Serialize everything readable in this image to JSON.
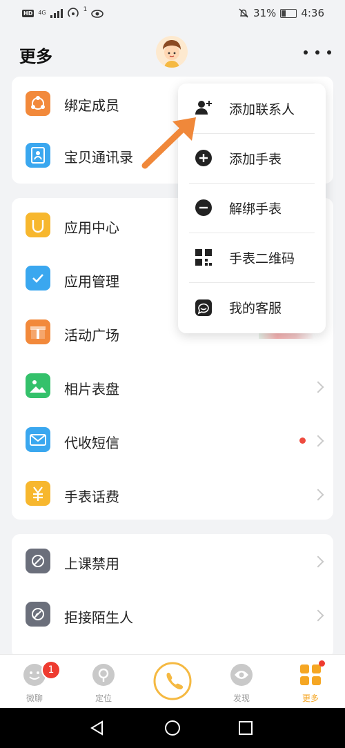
{
  "status_bar": {
    "signal_tag_left": "HD",
    "signal_small": "4G",
    "superscript": "1",
    "battery": "31%",
    "battery_level": 0.31,
    "time": "4:36"
  },
  "header": {
    "title": "更多"
  },
  "card1": {
    "items": [
      {
        "label": "绑定成员",
        "icon": "members-icon"
      },
      {
        "label": "宝贝通讯录",
        "icon": "contacts-icon"
      }
    ]
  },
  "card2": {
    "items": [
      {
        "label": "应用中心",
        "icon": "app-center-icon"
      },
      {
        "label": "应用管理",
        "icon": "app-manage-icon"
      },
      {
        "label": "活动广场",
        "icon": "gift-icon"
      },
      {
        "label": "相片表盘",
        "icon": "photo-icon"
      },
      {
        "label": "代收短信",
        "icon": "sms-icon"
      },
      {
        "label": "手表话费",
        "icon": "yuan-icon"
      }
    ]
  },
  "card3": {
    "items": [
      {
        "label": "上课禁用",
        "icon": "class-ban-icon"
      },
      {
        "label": "拒接陌生人",
        "icon": "reject-stranger-icon"
      }
    ]
  },
  "popup": {
    "items": [
      {
        "label": "添加联系人",
        "icon": "add-contact-icon"
      },
      {
        "label": "添加手表",
        "icon": "plus-circle-icon"
      },
      {
        "label": "解绑手表",
        "icon": "minus-circle-icon"
      },
      {
        "label": "手表二维码",
        "icon": "qr-code-icon"
      },
      {
        "label": "我的客服",
        "icon": "service-chat-icon"
      }
    ]
  },
  "bottom_nav": {
    "tabs": [
      {
        "label": "微聊",
        "badge": "1"
      },
      {
        "label": "定位"
      },
      {
        "label": ""
      },
      {
        "label": "发现"
      },
      {
        "label": "更多"
      }
    ]
  },
  "colors": {
    "accent": "#f5a623",
    "arrow": "#f0883a",
    "badge": "#ee3b30",
    "bg": "#f2f3f5"
  }
}
